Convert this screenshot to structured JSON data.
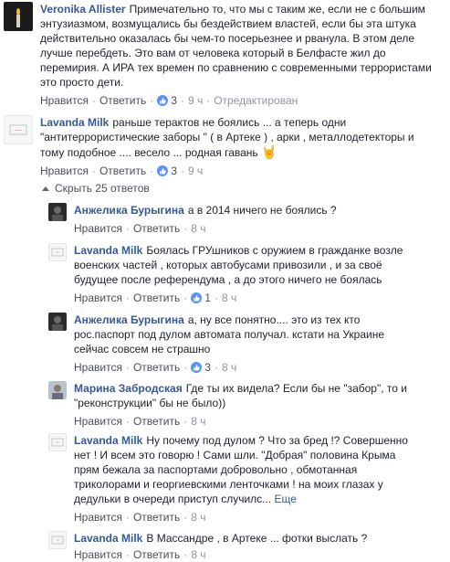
{
  "comments": [
    {
      "author": "Veronika Allister",
      "text": "Примечательно то, что мы с таким же, если не с большим энтузиазмом, возмущались бы бездействием властей, если бы эта штука действительно оказалась бы чем-то посерьезнее и рванула. В этом деле лучше перебдеть. Это вам от человека который в Белфасте жил до перемирия. А ИРА тех времен по сравнению с современными террористами это просто дети.",
      "like": "Нравится",
      "reply": "Ответить",
      "likes": "3",
      "time": "9 ч",
      "edited": "Отредактирован"
    },
    {
      "author": "Lavanda Milk",
      "text": "раньше терактов не боялись ... а теперь одни \"антитеррористические заборы \" ( в Артеке ) , арки , металлодетекторы и тому подобное .... весело ... родная гавань",
      "like": "Нравится",
      "reply": "Ответить",
      "likes": "3",
      "time": "9 ч"
    }
  ],
  "collapse_label": "Скрыть 25 ответов",
  "replies": [
    {
      "author": "Анжелика Бурыгина",
      "text": "а в 2014 ничего не боялись ?",
      "like": "Нравится",
      "reply": "Ответить",
      "likes": "",
      "time": "8 ч"
    },
    {
      "author": "Lavanda Milk",
      "text": "Боялась ГРУшников с оружием в гражданке возле военских частей , которых автобусами привозили , и за своё будущее после референдума , а до этого ничего не боялась",
      "like": "Нравится",
      "reply": "Ответить",
      "likes": "1",
      "time": "8 ч"
    },
    {
      "author": "Анжелика Бурыгина",
      "text": "а, ну все понятно.... это из тех кто рос.паспорт под дулом автомата получал. кстати на Украине сейчас совсем не страшно",
      "like": "Нравится",
      "reply": "Ответить",
      "likes": "3",
      "time": "8 ч"
    },
    {
      "author": "Марина Забродская",
      "text": "Где ты их видела? Если бы не \"забор\", то и \"реконструкции\" бы не было))",
      "like": "Нравится",
      "reply": "Ответить",
      "likes": "",
      "time": "8 ч"
    },
    {
      "author": "Lavanda Milk",
      "text": "Ну почему под дулом ? Что за бред !? Совершенно нет ! И всем это говорю ! Сами шли. \"Добрая\" половина Крыма прям бежала за паспортами добровольно , обмотанная триколорами и георгиевскими ленточками ! на моих глазах у дедульки в очереди приступ случилс...",
      "more": "Еще",
      "like": "Нравится",
      "reply": "Ответить",
      "likes": "",
      "time": "8 ч"
    },
    {
      "author": "Lavanda Milk",
      "text": "В Массандре , в Артеке ... фотки выслать ?",
      "like": "Нравится",
      "reply": "Ответить",
      "likes": "",
      "time": "8 ч"
    }
  ],
  "emoji": "🤘",
  "colors": {
    "link": "#365899",
    "like_badge": "#5890ff",
    "text": "#1d2129",
    "meta": "#90949c"
  }
}
